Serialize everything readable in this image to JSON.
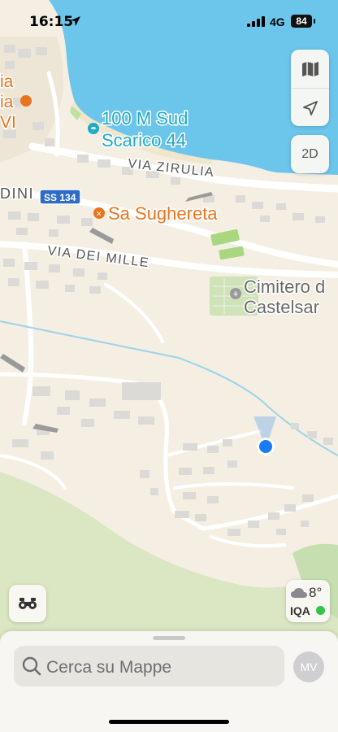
{
  "status_bar": {
    "time": "16:15",
    "network": "4G",
    "battery": "84"
  },
  "map_labels": {
    "beach_line1": "100 M Sud",
    "beach_line2": "Scarico 44",
    "street_zirulia": "VIA ZIRULIA",
    "street_mille": "VIA DEI MILLE",
    "road_shield": "SS 134",
    "restaurant": "Sa Sughereta",
    "cemetery_line1": "Cimitero d",
    "cemetery_line2": "Castelsar",
    "partial_left_1": "ia",
    "partial_left_2": "ia",
    "partial_left_3": "VI",
    "partial_dini": "DINI"
  },
  "controls": {
    "map_mode_icon": "map-icon",
    "locate_icon": "location-arrow-icon",
    "view_toggle": "2D",
    "lookaround_icon": "binoculars-icon"
  },
  "weather": {
    "temp": "8°",
    "aqi_label": "IQA",
    "aqi_color": "#31c447"
  },
  "search": {
    "placeholder": "Cerca su Mappe",
    "avatar_initials": "MV"
  },
  "colors": {
    "water": "#6cc5eb",
    "land": "#f4efe2",
    "vegetation": "#dde8c4",
    "poi_orange": "#e8741e",
    "beach_cyan": "#1fa9c9",
    "user_dot": "#1a7cf2"
  }
}
